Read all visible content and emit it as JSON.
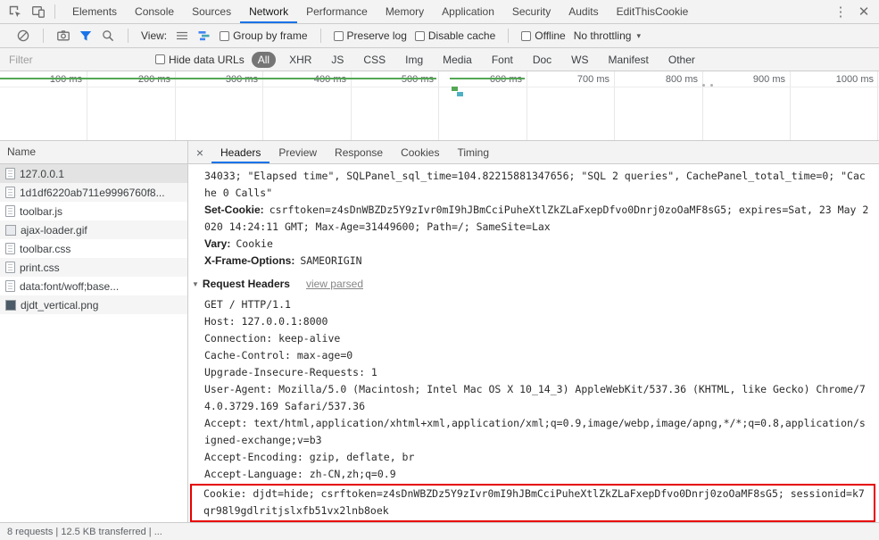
{
  "icons": {
    "more_menu": "⋮",
    "close": "✕",
    "subtab_close": "×",
    "caret_down": "▾",
    "triangle_down": "▼"
  },
  "colors": {
    "accent-blue": "#1a73e8",
    "record-red": "#e8453c",
    "overview-green": "#54a754",
    "overview-teal": "#4fb0c4",
    "highlight-red": "#e60000",
    "pill-bg": "#757575"
  },
  "main_tabs": {
    "items": [
      "Elements",
      "Console",
      "Sources",
      "Network",
      "Performance",
      "Memory",
      "Application",
      "Security",
      "Audits",
      "EditThisCookie"
    ],
    "active": "Network"
  },
  "toolbar": {
    "view_label": "View:",
    "group_by_frame": "Group by frame",
    "preserve_log": "Preserve log",
    "disable_cache": "Disable cache",
    "offline": "Offline",
    "throttling": "No throttling"
  },
  "filter_bar": {
    "placeholder": "Filter",
    "hide_data_urls": "Hide data URLs",
    "types": [
      "All",
      "XHR",
      "JS",
      "CSS",
      "Img",
      "Media",
      "Font",
      "Doc",
      "WS",
      "Manifest",
      "Other"
    ],
    "active_type": "All"
  },
  "timeline": {
    "ticks": [
      "100 ms",
      "200 ms",
      "300 ms",
      "400 ms",
      "500 ms",
      "600 ms",
      "700 ms",
      "800 ms",
      "900 ms",
      "1000 ms"
    ]
  },
  "request_list": {
    "header": "Name",
    "items": [
      {
        "name": "127.0.0.1",
        "icon": "document-icon"
      },
      {
        "name": "1d1df6220ab711e9996760f8...",
        "icon": "file-icon"
      },
      {
        "name": "toolbar.js",
        "icon": "script-icon"
      },
      {
        "name": "ajax-loader.gif",
        "icon": "image-icon"
      },
      {
        "name": "toolbar.css",
        "icon": "stylesheet-icon"
      },
      {
        "name": "print.css",
        "icon": "stylesheet-icon"
      },
      {
        "name": "data:font/woff;base...",
        "icon": "font-icon"
      },
      {
        "name": "djdt_vertical.png",
        "icon": "image-icon"
      }
    ]
  },
  "details": {
    "subtabs": [
      "Headers",
      "Preview",
      "Response",
      "Cookies",
      "Timing"
    ],
    "active_subtab": "Headers",
    "response_overflow": "34033; \"Elapsed time\", SQLPanel_sql_time=104.82215881347656; \"SQL 2 queries\", CachePanel_total_time=0; \"Cache 0 Calls\"",
    "response_headers": [
      {
        "name": "Set-Cookie:",
        "value": "csrftoken=z4sDnWBZDz5Y9zIvr0mI9hJBmCciPuheXtlZkZLaFxepDfvo0Dnrj0zoOaMF8sG5; expires=Sat, 23 May 2020 14:24:11 GMT; Max-Age=31449600; Path=/; SameSite=Lax"
      },
      {
        "name": "Vary:",
        "value": "Cookie"
      },
      {
        "name": "X-Frame-Options:",
        "value": "SAMEORIGIN"
      }
    ],
    "request_headers_title": "Request Headers",
    "view_parsed_label": "view parsed",
    "request_lines": [
      "GET / HTTP/1.1",
      "Host: 127.0.0.1:8000",
      "Connection: keep-alive",
      "Cache-Control: max-age=0",
      "Upgrade-Insecure-Requests: 1",
      "User-Agent: Mozilla/5.0 (Macintosh; Intel Mac OS X 10_14_3) AppleWebKit/537.36 (KHTML, like Gecko) Chrome/74.0.3729.169 Safari/537.36",
      "Accept: text/html,application/xhtml+xml,application/xml;q=0.9,image/webp,image/apng,*/*;q=0.8,application/signed-exchange;v=b3",
      "Accept-Encoding: gzip, deflate, br",
      "Accept-Language: zh-CN,zh;q=0.9"
    ],
    "cookie_line": "Cookie: djdt=hide; csrftoken=z4sDnWBZDz5Y9zIvr0mI9hJBmCciPuheXtlZkZLaFxepDfvo0Dnrj0zoOaMF8sG5; sessionid=k7qr98l9gdlritjslxfb51vx2lnb8oek"
  },
  "status_bar": {
    "text": "8 requests  |  12.5 KB transferred  |  ..."
  }
}
